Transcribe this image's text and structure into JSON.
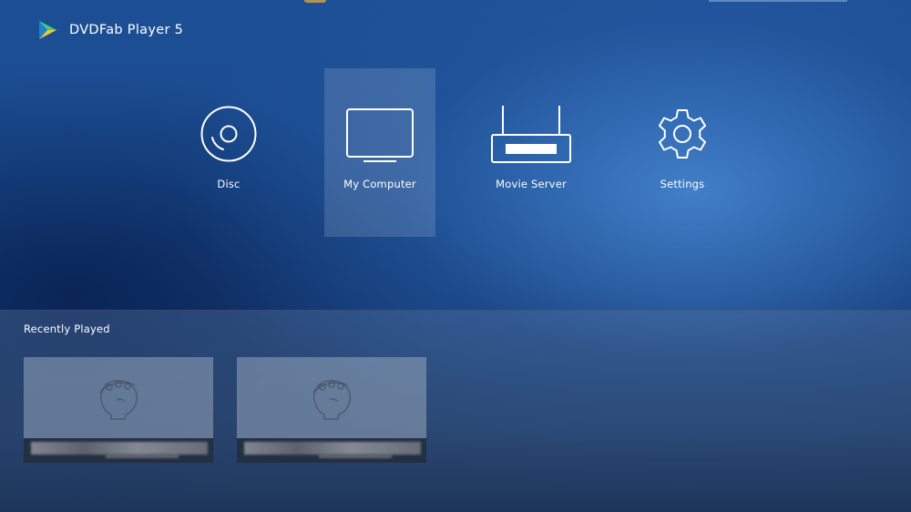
{
  "app": {
    "title": "DVDFab Player 5",
    "accent_colors": [
      "#3fd07a",
      "#2a9fe0",
      "#f2c532"
    ]
  },
  "menu": {
    "items": [
      {
        "label": "Disc",
        "icon": "disc-icon",
        "selected": false
      },
      {
        "label": "My Computer",
        "icon": "monitor-icon",
        "selected": true
      },
      {
        "label": "Movie Server",
        "icon": "router-icon",
        "selected": false
      },
      {
        "label": "Settings",
        "icon": "gear-icon",
        "selected": false
      }
    ]
  },
  "recent": {
    "title": "Recently Played",
    "items": [
      {
        "thumbnail_icon": "movie-placeholder-icon"
      },
      {
        "thumbnail_icon": "movie-placeholder-icon"
      }
    ]
  }
}
